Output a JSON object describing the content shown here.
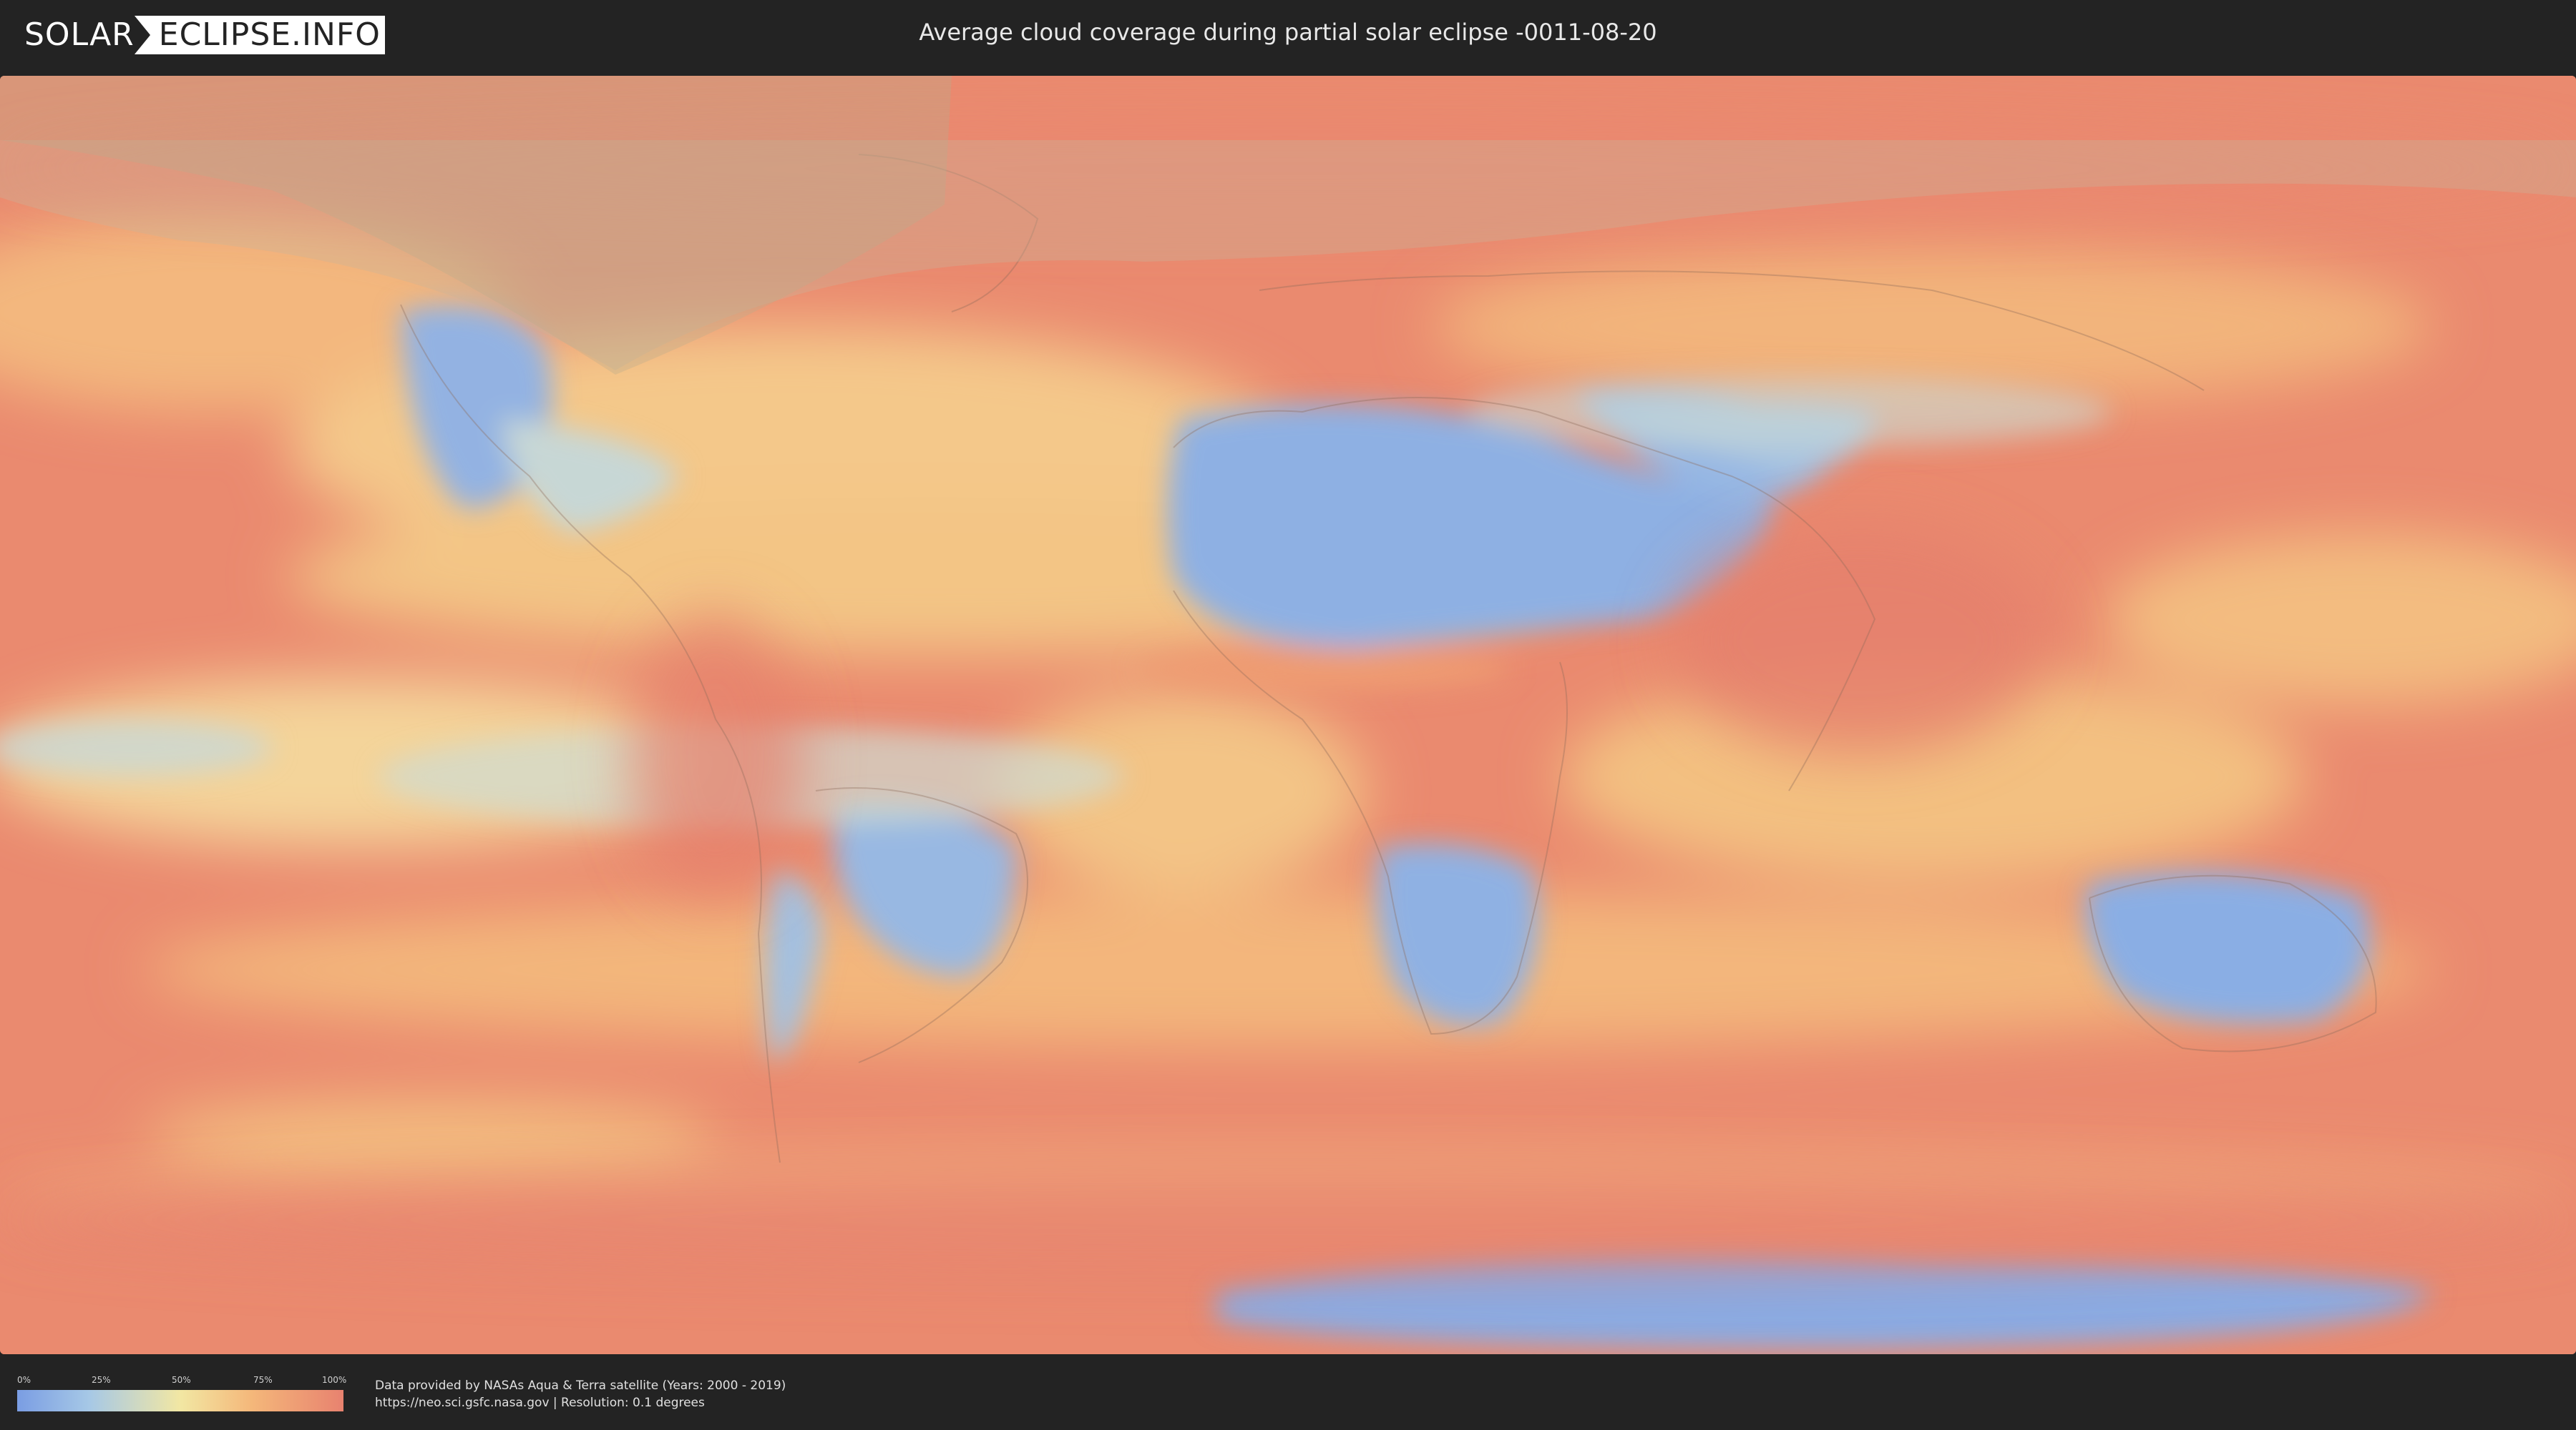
{
  "header": {
    "logo_left": "SOLAR",
    "logo_right": "ECLIPSE.INFO",
    "title": "Average cloud coverage during partial solar eclipse -0011-08-20"
  },
  "legend": {
    "ticks": [
      "0%",
      "25%",
      "50%",
      "75%",
      "100%"
    ],
    "colors": [
      "#7a9de3",
      "#a6c8e6",
      "#f2e7a3",
      "#f4b77a",
      "#e8826f"
    ]
  },
  "credits": {
    "line1": "Data provided by NASAs Aqua & Terra satellite (Years: 2000 - 2019)",
    "line2": "https://neo.sci.gsfc.nasa.gov | Resolution: 0.1 degrees"
  }
}
